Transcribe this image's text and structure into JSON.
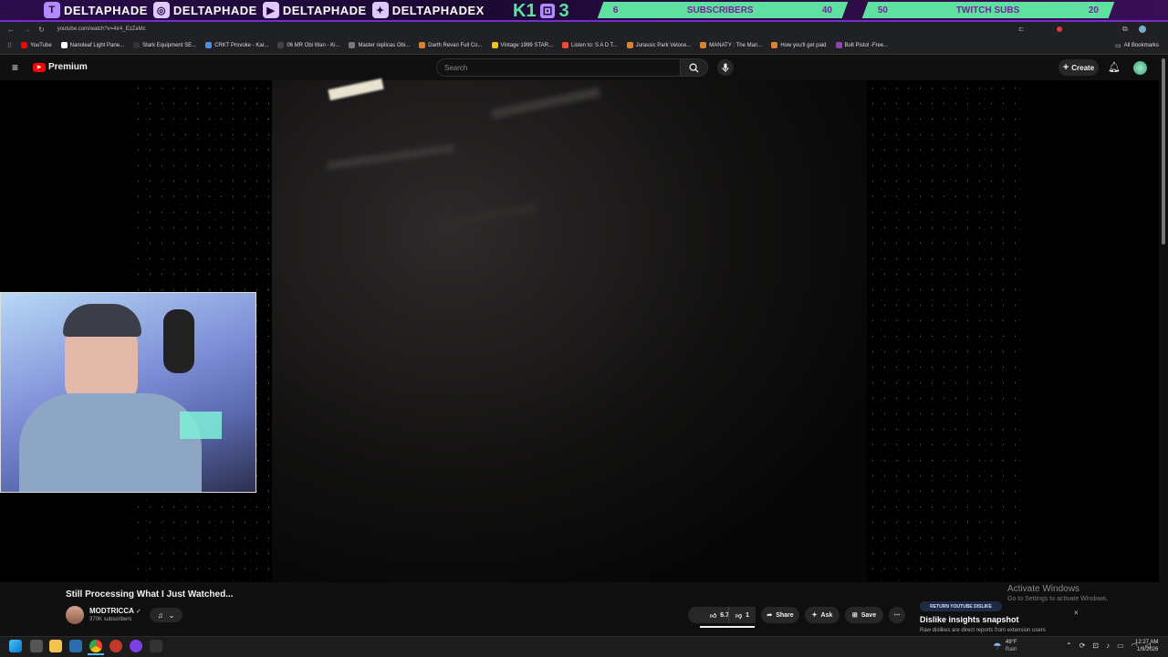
{
  "overlay": {
    "handles": [
      "DELTAPHADE",
      "DELTAPHADE",
      "DELTAPHADE",
      "DELTAPHADEX"
    ],
    "badge_k": "K1",
    "badge_num": "3",
    "subs_goal": {
      "current": "6",
      "label": "SUBSCRIBERS",
      "target": "40"
    },
    "twitch_goal": {
      "current": "50",
      "label": "TWITCH SUBS",
      "target": "20"
    }
  },
  "browser": {
    "url": "youtube.com/watch?v=4ir4_EzZaMc",
    "bookmarks": [
      "YouTube",
      "Nanoleaf Light Pane...",
      "Stark Equipment SE...",
      "CRKT Provoke - Kar...",
      "06 MR Obi Wan - Ki...",
      "Master replicas Obi...",
      "Darth Revan Full Co...",
      "Vintage 1999 STAR...",
      "Listen to: S A D T...",
      "Jurassic Park Veloce...",
      "MANATY : The Man...",
      "How you'll get paid",
      "Bolt Pistol -Free..."
    ],
    "all_bookmarks": "All Bookmarks"
  },
  "youtube": {
    "logo_text": "Premium",
    "search_placeholder": "Search",
    "create_label": "Create"
  },
  "video": {
    "title": "Still Processing What I Just Watched...",
    "channel": "MODTRICCA",
    "subscribers": "370K subscribers",
    "likes": "6.7K",
    "dislikes": "1",
    "share_label": "Share",
    "ask_label": "Ask",
    "save_label": "Save"
  },
  "dislike_ext": {
    "badge": "RETURN YOUTUBE DISLIKE",
    "title": "Dislike insights snapshot",
    "subtitle": "Raw dislikes are direct reports from extension users"
  },
  "windows": {
    "activate_title": "Activate Windows",
    "activate_sub": "Go to Settings to activate Windows.",
    "weather_temp": "49°F",
    "weather_desc": "Rain",
    "time": "12:27 AM",
    "date": "1/9/2026"
  },
  "colors": {
    "accent": "#5fe0a0",
    "overlay_bg": "#1b0a33",
    "youtube_red": "#ff0000"
  }
}
